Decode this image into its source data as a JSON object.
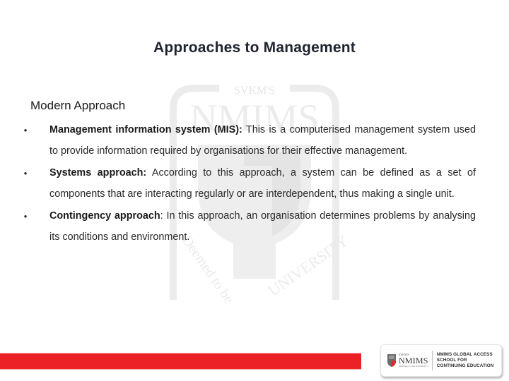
{
  "slide": {
    "title": "Approaches to Management",
    "section_heading": "Modern Approach",
    "bullets": [
      {
        "term": "Management information system (MIS):",
        "description": " This is a computerised management system used to provide information required by organisations for their effective management."
      },
      {
        "term": "Systems approach:",
        "description": " According to this approach, a system can be defined as a set of components that are interacting regularly or are interdependent, thus making a single unit."
      },
      {
        "term": "Contingency approach",
        "description": ": In this approach, an organisation determines problems by analysing its conditions and environment."
      }
    ],
    "bullet_glyph": "•"
  },
  "watermark": {
    "top_text": "SVKM'S",
    "main_text": "NMIMS",
    "arc_text_left": "Deemed to be",
    "arc_text_right": "UNIVERSITY"
  },
  "footer": {
    "bar_color": "#ec2128",
    "logo": {
      "svkm": "SVKM'S",
      "wordmark": "NMIMS",
      "sub": "DEEMED-TO-BE UNIVERSITY",
      "lines": [
        "NMIMS GLOBAL ACCESS",
        "SCHOOL FOR",
        "CONTINUING EDUCATION"
      ]
    }
  }
}
